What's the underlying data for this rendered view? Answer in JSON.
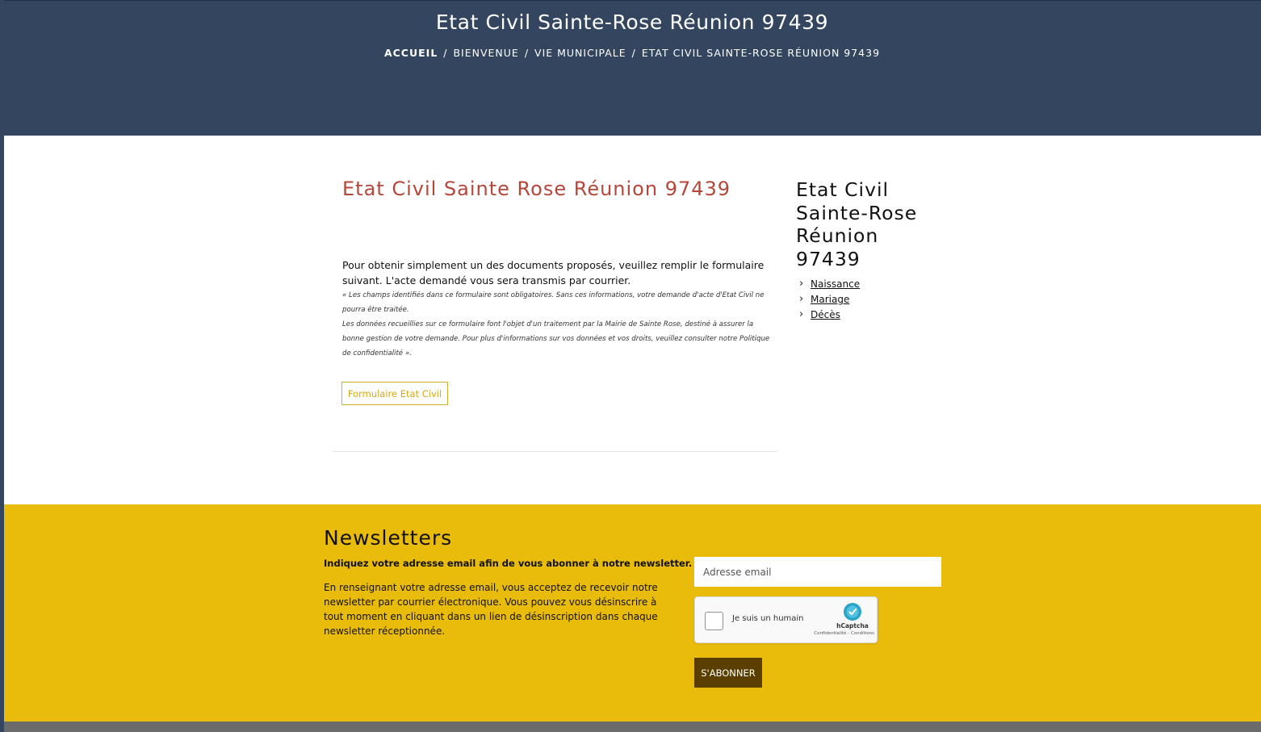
{
  "header": {
    "title": "Etat Civil Sainte-Rose Réunion 97439",
    "breadcrumb": {
      "home": "ACCUEIL",
      "items": [
        "BIENVENUE",
        "VIE MUNICIPALE",
        "ETAT CIVIL SAINTE-ROSE RÉUNION 97439"
      ],
      "separator": "/"
    }
  },
  "main": {
    "title": "Etat Civil Sainte Rose Réunion 97439",
    "intro": "Pour obtenir simplement un des documents proposés, veuillez remplir le formulaire suivant. L'acte demandé vous sera transmis par courrier.",
    "notice_1": "« Les champs identifiés dans ce formulaire sont obligatoires. Sans ces informations, votre demande d'acte d'Etat Civil ne pourra être traitée.",
    "notice_2": "Les données recueillies sur ce formulaire font l'objet d'un traitement par la Mairie de Sainte Rose, destiné à assurer la bonne gestion de votre demande. Pour plus d'informations sur vos données et vos droits, veuillez consulter notre Politique de confidentialité ».",
    "form_button": "Formulaire Etat Civil"
  },
  "sidebar": {
    "title": "Etat Civil Sainte-Rose Réunion 97439",
    "links": [
      "Naissance",
      "Mariage",
      "Décès"
    ]
  },
  "newsletter": {
    "title": "Newsletters",
    "lead": "Indiquez votre adresse email afin de vous abonner à notre newsletter.",
    "text": "En renseignant votre adresse email, vous acceptez de recevoir notre newsletter par courrier électronique. Vous pouvez vous désinscrire à tout moment en cliquant dans un lien de désinscription dans chaque newsletter réceptionnée.",
    "email_placeholder": "Adresse email",
    "captcha_label": "Je suis un humain",
    "captcha_brand": "hCaptcha",
    "captcha_links": "Confidentialité - Conditions",
    "subscribe_label": "S'ABONNER"
  },
  "colors": {
    "header_bg": "#34465f",
    "title_red": "#b5473a",
    "newsletter_bg": "#e9bb0b",
    "subscribe_bg": "#5a3f00",
    "button_outline": "#d4b02a"
  }
}
